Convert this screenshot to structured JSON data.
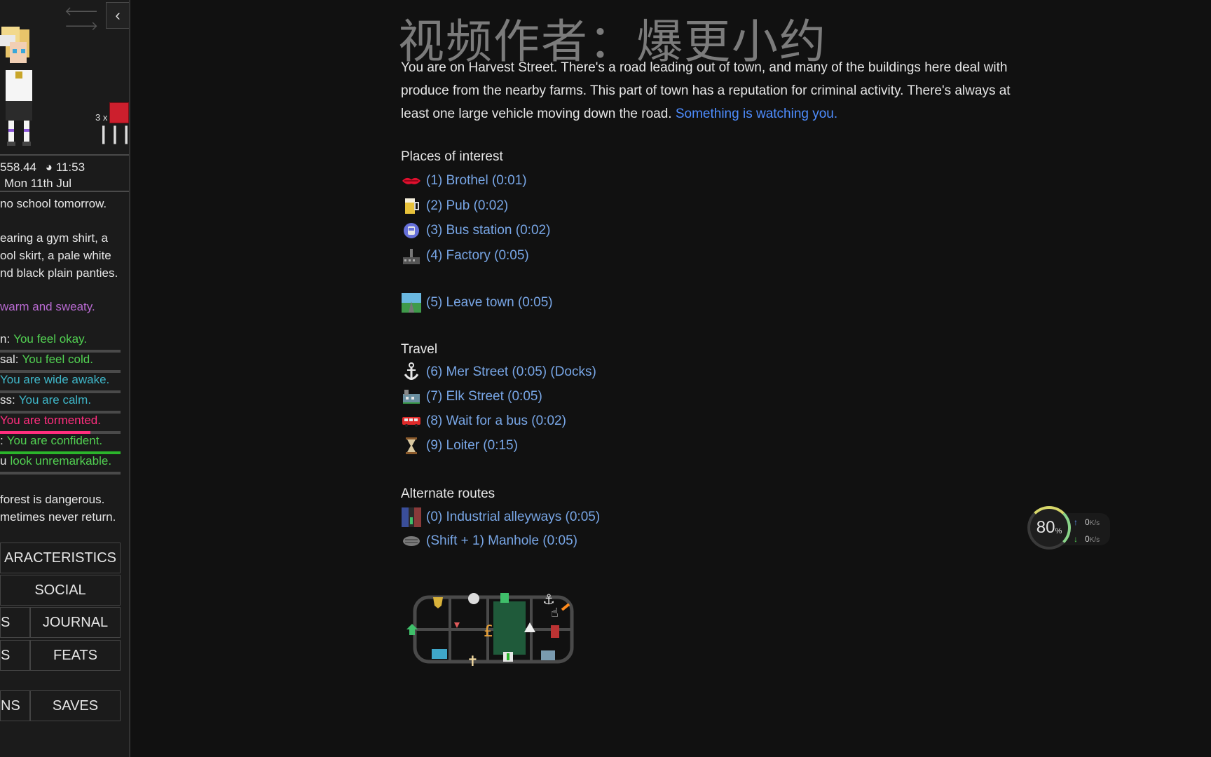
{
  "watermark": "视频作者：爆更小约",
  "sidebar": {
    "nav_arrows": "🡐 🡒",
    "collapse_label": "‹",
    "pill_count": "3 x",
    "money": "558.44",
    "time": "11:53",
    "date": "Mon 11th Jul",
    "school_notice": "no school tomorrow.",
    "outfit": "earing a gym shirt, a ool skirt, a pale white nd black plain panties.",
    "warm": "warm and sweaty.",
    "stats": [
      {
        "label": "n:",
        "value": "You feel okay.",
        "color": "#52d152",
        "fill": 0.0,
        "fill_color": "#52d152"
      },
      {
        "label": "sal:",
        "value": "You feel cold.",
        "color": "#52d152",
        "fill": 0.0,
        "fill_color": "#52d152"
      },
      {
        "label": "",
        "value": "You are wide awake.",
        "color": "#3fb7c9",
        "fill": 0.0,
        "fill_color": "#3fb7c9"
      },
      {
        "label": "ss:",
        "value": "You are calm.",
        "color": "#3fb7c9",
        "fill": 0.0,
        "fill_color": "#3fb7c9"
      },
      {
        "label": "",
        "value": "You are tormented.",
        "color": "#ff2e7e",
        "fill": 0.75,
        "fill_color": "#ff2e7e"
      },
      {
        "label": ":",
        "value": "You are confident.",
        "color": "#52d152",
        "fill": 1.0,
        "fill_color": "#2bb52b"
      },
      {
        "label": "u",
        "value": "look unremarkable.",
        "color": "#52d152",
        "fill": 0.0,
        "fill_color": "#52d152"
      }
    ],
    "forest": "forest is dangerous. metimes never return.",
    "buttons": {
      "characteristics": "ARACTERISTICS",
      "social": "SOCIAL",
      "left_partial_1": "S",
      "journal": "JOURNAL",
      "left_partial_2": "S",
      "feats": "FEATS",
      "options_partial": "NS",
      "saves": "SAVES"
    }
  },
  "main": {
    "description": "You are on Harvest Street. There's a road leading out of town, and many of the buildings here deal with produce from the nearby farms. This part of town has a reputation for criminal activity. There's always at least one large vehicle moving down the road.",
    "description_highlight": "Something is watching you.",
    "places_title": "Places of interest",
    "places": [
      {
        "label": "(1) Brothel (0:01)",
        "icon": "lips-icon"
      },
      {
        "label": "(2) Pub (0:02)",
        "icon": "beer-icon"
      },
      {
        "label": "(3) Bus station (0:02)",
        "icon": "bus-station-icon"
      },
      {
        "label": "(4) Factory (0:05)",
        "icon": "factory-icon"
      },
      {
        "label": "(5) Leave town (0:05)",
        "icon": "road-icon"
      }
    ],
    "travel_title": "Travel",
    "travel": [
      {
        "label": "(6) Mer Street (0:05) (Docks)",
        "icon": "anchor-icon"
      },
      {
        "label": "(7) Elk Street (0:05)",
        "icon": "building-icon"
      },
      {
        "label": "(8) Wait for a bus (0:02)",
        "icon": "bus-icon"
      },
      {
        "label": "(9) Loiter (0:15)",
        "icon": "hourglass-icon"
      }
    ],
    "alt_title": "Alternate routes",
    "alternate": [
      {
        "label": "(0) Industrial alleyways (0:05)",
        "icon": "alley-icon"
      },
      {
        "label": "(Shift + 1) Manhole (0:05)",
        "icon": "manhole-icon"
      }
    ]
  },
  "network": {
    "percent": "80",
    "percent_unit": "%",
    "up": "0",
    "down": "0",
    "unit": "K/s"
  }
}
